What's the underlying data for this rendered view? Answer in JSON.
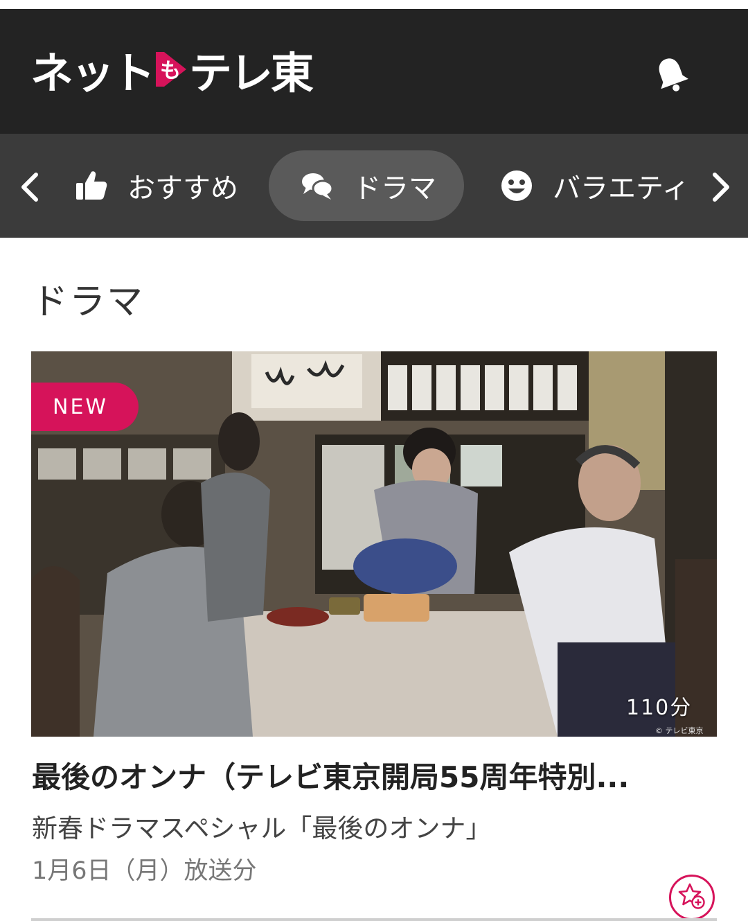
{
  "header": {
    "logo_part1": "ネット",
    "logo_mark": "も",
    "logo_part2": "テレ東",
    "bell_icon": "bell-icon"
  },
  "nav": {
    "prev_icon": "chevron-left-icon",
    "next_icon": "chevron-right-icon",
    "items": [
      {
        "label": "おすすめ",
        "icon": "thumbs-up-icon",
        "active": false
      },
      {
        "label": "ドラマ",
        "icon": "chat-bubbles-icon",
        "active": true
      },
      {
        "label": "バラエティ",
        "icon": "smiley-icon",
        "active": false
      }
    ]
  },
  "section": {
    "title": "ドラマ"
  },
  "program": {
    "badge": "NEW",
    "duration": "110分",
    "copyright": "© テレビ東京",
    "title": "最後のオンナ（テレビ東京開局55周年特別...",
    "subtitle": "新春ドラマスペシャル「最後のオンナ」",
    "date": "1月6日（月）放送分",
    "favorite_icon": "star-add-icon"
  },
  "colors": {
    "header_bg": "#232323",
    "nav_bg": "#3b3b3b",
    "nav_active_bg": "#5a5a5a",
    "accent": "#d6135a"
  }
}
